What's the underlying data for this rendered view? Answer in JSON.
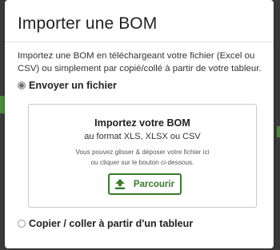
{
  "dialog": {
    "title": "Importer une BOM",
    "intro": "Importez une BOM en téléchargeant votre fichier (Excel ou CSV) ou simplement par copié/collé à partir de votre tableur."
  },
  "options": [
    {
      "label": "Envoyer un fichier",
      "selected": true
    },
    {
      "label": "Copier / coller à partir d'un tableur",
      "selected": false
    }
  ],
  "dropzone": {
    "title": "Importez votre BOM",
    "format": "au format XLS, XLSX ou CSV",
    "help_line_1": "Vous pouvez glisser & déposer votre fichier ici",
    "help_line_2": "ou cliquer sur le bouton ci-dessous.",
    "browse_label": "Parcourir",
    "browse_icon": "upload-icon"
  },
  "colors": {
    "accent": "#3b7a2c"
  }
}
